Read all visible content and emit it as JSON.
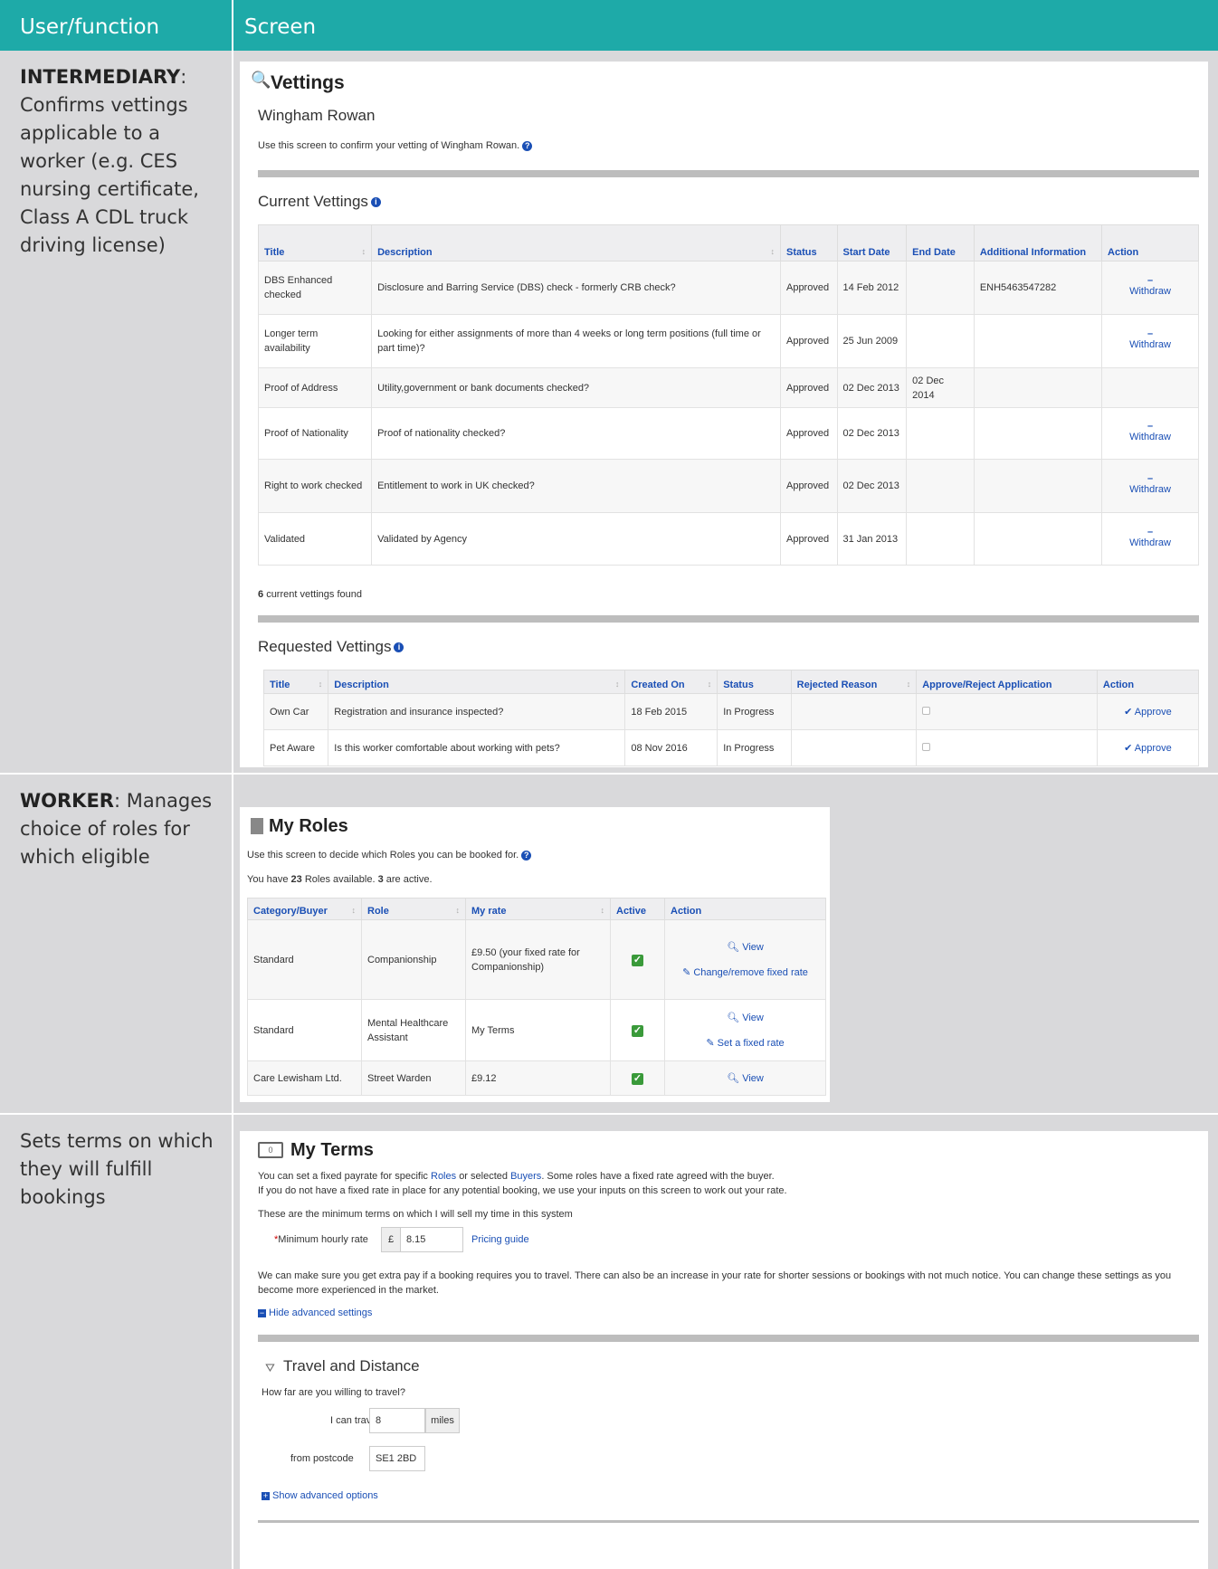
{
  "header": {
    "col1": "User/function",
    "col2": "Screen"
  },
  "rows": [
    {
      "role": "INTERMEDIARY",
      "text": "Confirms vettings applicable to a worker (e.g. CES nursing certificate, Class A CDL truck driving license)"
    },
    {
      "role": "WORKER",
      "text": "Manages choice of roles for which eligible"
    },
    {
      "role": "",
      "text": "Sets terms on which they will fulfill bookings"
    }
  ],
  "vettings": {
    "title": "Vettings",
    "person": "Wingham Rowan",
    "intro": "Use this screen to confirm your vetting of Wingham Rowan.",
    "current_title": "Current Vettings",
    "current_headers": [
      "Title",
      "Description",
      "Status",
      "Start Date",
      "End Date",
      "Additional Information",
      "Action"
    ],
    "current_rows": [
      {
        "title": "DBS Enhanced checked",
        "description": "Disclosure and Barring Service (DBS) check - formerly CRB check?",
        "status": "Approved",
        "start": "14 Feb 2012",
        "end": "",
        "info": "ENH5463547282",
        "action": "Withdraw"
      },
      {
        "title": "Longer term availability",
        "description": "Looking for either assignments of more than 4 weeks or long term positions (full time or part time)?",
        "status": "Approved",
        "start": "25 Jun 2009",
        "end": "",
        "info": "",
        "action": "Withdraw"
      },
      {
        "title": "Proof of Address",
        "description": "Utility,government or bank documents checked?",
        "status": "Approved",
        "start": "02 Dec 2013",
        "end": "02 Dec 2014",
        "info": "",
        "action": ""
      },
      {
        "title": "Proof of Nationality",
        "description": "Proof of nationality checked?",
        "status": "Approved",
        "start": "02 Dec 2013",
        "end": "",
        "info": "",
        "action": "Withdraw"
      },
      {
        "title": "Right to work checked",
        "description": "Entitlement to work in UK checked?",
        "status": "Approved",
        "start": "02 Dec 2013",
        "end": "",
        "info": "",
        "action": "Withdraw"
      },
      {
        "title": "Validated",
        "description": "Validated by Agency",
        "status": "Approved",
        "start": "31 Jan 2013",
        "end": "",
        "info": "",
        "action": "Withdraw"
      }
    ],
    "found_count": "6",
    "found_text": "current vettings found",
    "requested_title": "Requested Vettings",
    "requested_headers": [
      "Title",
      "Description",
      "Created On",
      "Status",
      "Rejected Reason",
      "Approve/Reject Application",
      "Action"
    ],
    "requested_rows": [
      {
        "title": "Own Car",
        "description": "Registration and insurance inspected?",
        "created": "18 Feb 2015",
        "status": "In Progress",
        "reason": "",
        "action": "Approve"
      },
      {
        "title": "Pet Aware",
        "description": "Is this worker comfortable about working with pets?",
        "created": "08 Nov 2016",
        "status": "In Progress",
        "reason": "",
        "action": "Approve"
      }
    ]
  },
  "roles": {
    "title": "My Roles",
    "intro": "Use this screen to decide which Roles you can be booked for.",
    "summary_pre": "You have",
    "summary_count": "23",
    "summary_mid": "Roles available.",
    "summary_active": "3",
    "summary_post": "are active.",
    "headers": [
      "Category/Buyer",
      "Role",
      "My rate",
      "Active",
      "Action"
    ],
    "rows": [
      {
        "category": "Standard",
        "role": "Companionship",
        "rate": "£9.50 (your fixed rate for Companionship)",
        "actions": [
          "View",
          "Change/remove fixed rate"
        ]
      },
      {
        "category": "Standard",
        "role": "Mental Healthcare Assistant",
        "rate": "My Terms",
        "actions": [
          "View",
          "Set a fixed rate"
        ]
      },
      {
        "category": "Care Lewisham Ltd.",
        "role": "Street Warden",
        "rate": "£9.12",
        "actions": [
          "View"
        ]
      }
    ]
  },
  "terms": {
    "title": "My Terms",
    "line1_pre": "You can set a fixed payrate for specific",
    "line1_roles": "Roles",
    "line1_mid": "or selected",
    "line1_buyers": "Buyers",
    "line1_post": ". Some roles have a fixed rate agreed with the buyer.",
    "line2": "If you do not have a fixed rate in place for any potential booking, we use your inputs on this screen to work out your rate.",
    "min_terms": "These are the minimum terms on which I will sell my time in this system",
    "min_rate_label": "Minimum hourly rate",
    "currency": "£",
    "min_rate_value": "8.15",
    "pricing_guide": "Pricing guide",
    "extra_pay": "We can make sure you get extra pay if a booking requires you to travel. There can also be an increase in your rate for shorter sessions or bookings with not much notice. You can change these settings as you become more experienced in the market.",
    "hide_advanced": "Hide advanced settings",
    "travel_title": "Travel and Distance",
    "travel_q": "How far are you willing to travel?",
    "travel_label": "I can travel",
    "travel_value": "8",
    "travel_unit": "miles",
    "postcode_label": "from postcode",
    "postcode_value": "SE1 2BD",
    "show_advanced": "Show advanced options"
  }
}
